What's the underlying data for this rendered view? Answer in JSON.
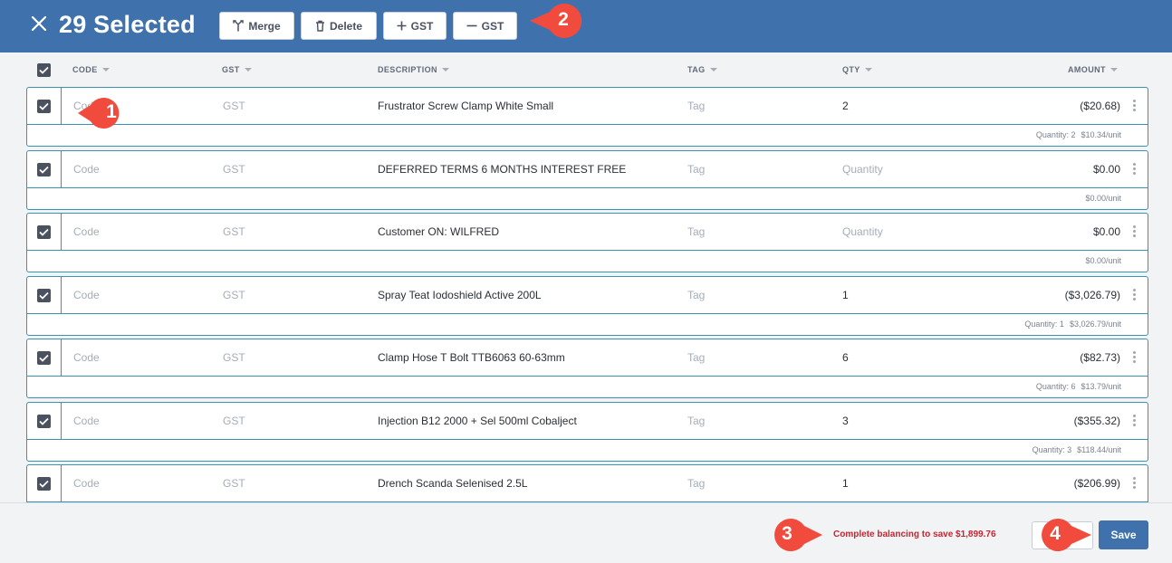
{
  "header": {
    "selected_title": "29 Selected",
    "buttons": {
      "merge": "Merge",
      "delete": "Delete",
      "add_gst": "GST",
      "remove_gst": "GST"
    }
  },
  "columns": {
    "code": "CODE",
    "gst": "GST",
    "description": "DESCRIPTION",
    "tag": "TAG",
    "qty": "QTY",
    "amount": "AMOUNT"
  },
  "rows": [
    {
      "code": "Code",
      "gst": "GST",
      "description": "Frustrator Screw Clamp White Small",
      "tag": "Tag",
      "qty": "2",
      "qty_is_placeholder": false,
      "amount": "($20.68)",
      "sub_quantity": "Quantity: 2",
      "sub_unit": "$10.34/unit"
    },
    {
      "code": "Code",
      "gst": "GST",
      "description": "DEFERRED TERMS 6 MONTHS INTEREST FREE",
      "tag": "Tag",
      "qty": "Quantity",
      "qty_is_placeholder": true,
      "amount": "$0.00",
      "sub_quantity": "",
      "sub_unit": "$0.00/unit"
    },
    {
      "code": "Code",
      "gst": "GST",
      "description": "Customer ON: WILFRED",
      "tag": "Tag",
      "qty": "Quantity",
      "qty_is_placeholder": true,
      "amount": "$0.00",
      "sub_quantity": "",
      "sub_unit": "$0.00/unit"
    },
    {
      "code": "Code",
      "gst": "GST",
      "description": "Spray Teat Iodoshield Active 200L",
      "tag": "Tag",
      "qty": "1",
      "qty_is_placeholder": false,
      "amount": "($3,026.79)",
      "sub_quantity": "Quantity: 1",
      "sub_unit": "$3,026.79/unit"
    },
    {
      "code": "Code",
      "gst": "GST",
      "description": "Clamp Hose T Bolt TTB6063 60-63mm",
      "tag": "Tag",
      "qty": "6",
      "qty_is_placeholder": false,
      "amount": "($82.73)",
      "sub_quantity": "Quantity: 6",
      "sub_unit": "$13.79/unit"
    },
    {
      "code": "Code",
      "gst": "GST",
      "description": "Injection B12 2000 + Sel 500ml Cobalject",
      "tag": "Tag",
      "qty": "3",
      "qty_is_placeholder": false,
      "amount": "($355.32)",
      "sub_quantity": "Quantity: 3",
      "sub_unit": "$118.44/unit"
    },
    {
      "code": "Code",
      "gst": "GST",
      "description": "Drench Scanda Selenised 2.5L",
      "tag": "Tag",
      "qty": "1",
      "qty_is_placeholder": false,
      "amount": "($206.99)",
      "sub_quantity": "",
      "sub_unit": ""
    }
  ],
  "footer": {
    "balance_message": "Complete balancing to save $1,899.76",
    "save_label": "Save"
  },
  "markers": [
    "1",
    "2",
    "3",
    "4"
  ],
  "colors": {
    "header_bg": "#3f72ad",
    "row_border": "#3a93b2",
    "marker": "#f04b3c",
    "warning_text": "#c8232f",
    "save_bg": "#3f72ad"
  },
  "icons": {
    "close": "close-icon",
    "merge": "merge-icon",
    "delete": "trash-icon",
    "add_gst": "plus-icon",
    "remove_gst": "minus-icon",
    "checkbox": "checkbox-checked-icon",
    "row_menu": "kebab-menu-icon",
    "sort": "caret-down-icon"
  }
}
